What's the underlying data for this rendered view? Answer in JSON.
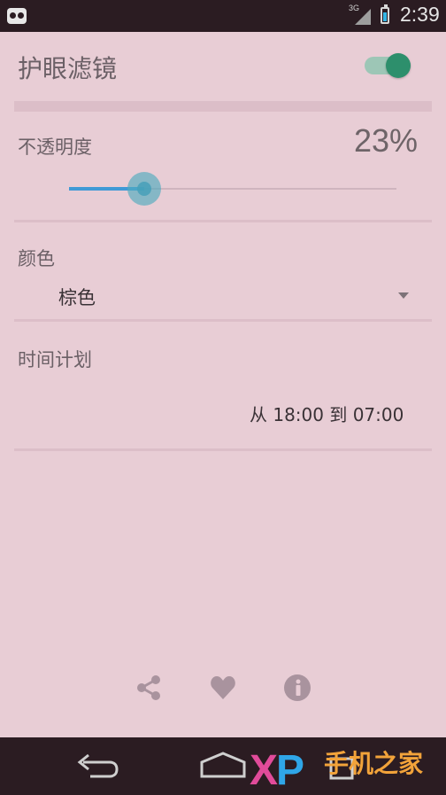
{
  "status_bar": {
    "network_label": "3G",
    "time": "2:39",
    "icons": [
      "app-notification-icon",
      "signal-icon",
      "battery-charging-icon"
    ]
  },
  "filter": {
    "title": "护眼滤镜",
    "enabled": true,
    "accent_color": "#2d8f6c"
  },
  "opacity": {
    "title": "不透明度",
    "value_text": "23%",
    "value": 0.23,
    "slider_color": "#3f9ad6"
  },
  "color": {
    "title": "颜色",
    "selected": "棕色"
  },
  "schedule": {
    "title": "时间计划",
    "range_text": "从 18:00 到 07:00"
  },
  "actions": [
    "share-icon",
    "heart-icon",
    "info-icon"
  ],
  "nav_bar": [
    "back-icon",
    "home-icon",
    "recent-apps-icon"
  ],
  "watermark": {
    "logo": "XP",
    "text": "手机之家"
  },
  "colors": {
    "background": "#e8cdd5",
    "bars": "#2b1c22"
  }
}
